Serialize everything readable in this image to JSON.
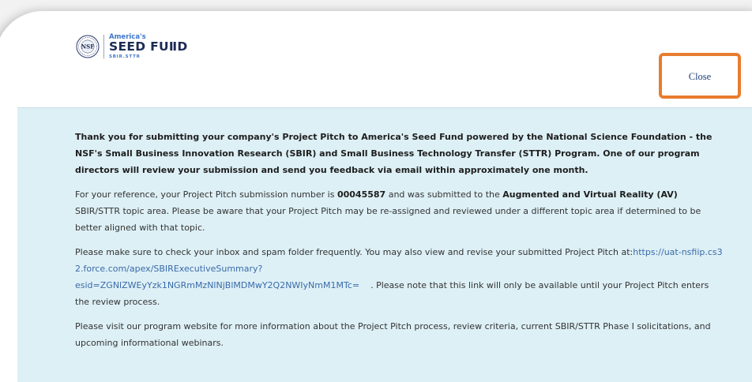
{
  "logo": {
    "line1": "America's",
    "line2": "SEED FUⅡD",
    "line3": "SBIR.STTR",
    "seal_text": "NSF"
  },
  "close_label": "Close",
  "colors": {
    "panel_bg": "#ddf0f6",
    "close_highlight": "#e87c2e",
    "brand_navy": "#1c2b55",
    "brand_blue": "#3f76c9",
    "link": "#3a6aa8"
  },
  "message": {
    "intro": "Thank you for submitting your company's Project Pitch to America's Seed Fund powered by the National Science Foundation - the NSF's Small Business Innovation Research (SBIR) and Small Business Technology Transfer (STTR) Program. One of our program directors will review your submission and send you feedback via email within approximately one month.",
    "ref_pre": "For your reference, your Project Pitch submission number is ",
    "submission_number": "00045587",
    "ref_mid": " and was submitted to the ",
    "topic_area": "Augmented and Virtual Reality (AV)",
    "ref_post": " SBIR/STTR topic area. Please be aware that your Project Pitch may be re-assigned and reviewed under a different topic area if determined to be better aligned with that topic.",
    "check_pre": "Please make sure to check your inbox and spam folder frequently. You may also view and revise your submitted Project Pitch at:",
    "link_line1": "https://uat-nsfiip.cs32.force.com/apex/SBIRExecutiveSummary?",
    "link_line2": "esid=ZGNlZWEyYzk1NGRmMzNlNjBlMDMwY2Q2NWIyNmM1MTc=",
    "check_post": "Please note that this link will only be available until your Project Pitch enters the review process.",
    "visit": "Please visit our program website for more information about the Project Pitch process, review criteria, current SBIR/STTR Phase I solicitations, and upcoming informational webinars."
  }
}
